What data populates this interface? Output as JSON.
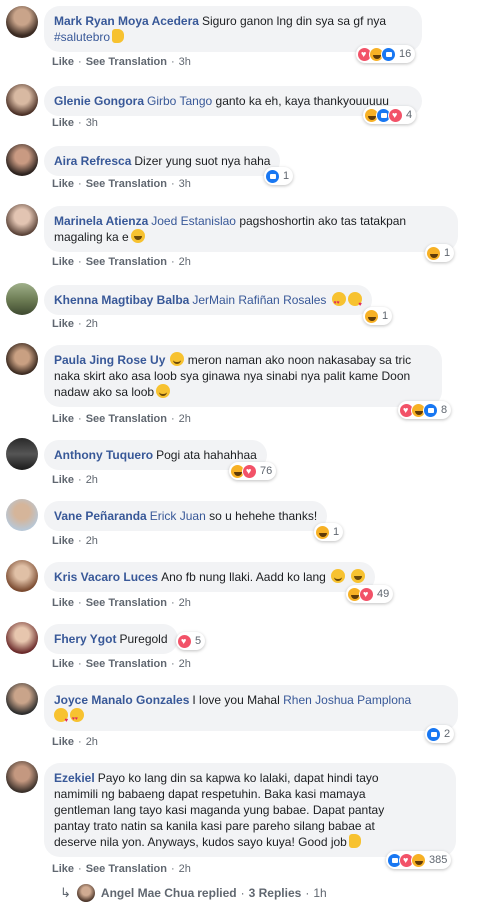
{
  "labels": {
    "like": "Like",
    "see_translation": "See Translation",
    "sep": "·"
  },
  "colors": {
    "author": "#385898",
    "bubble": "#f2f3f5",
    "meta": "#606770",
    "like_blue": "#1877f2",
    "love_red": "#f25268",
    "haha_yellow": "#f7b125"
  },
  "comments": [
    {
      "author": "Mark Ryan Moya Acedera",
      "text1": "Siguro ganon lng din sya sa gf nya",
      "text2": "#salutebro",
      "emoji": [
        "thumbs-up"
      ],
      "see_translation": true,
      "time": "3h",
      "reactions": [
        "love",
        "haha",
        "like"
      ],
      "count": "16"
    },
    {
      "author": "Glenie Gongora",
      "mention": "Girbo Tango",
      "text": "ganto ka eh, kaya thankyouuuuu",
      "see_translation": false,
      "time": "3h",
      "reactions": [
        "haha",
        "like",
        "love"
      ],
      "count": "4"
    },
    {
      "author": "Aira Refresca",
      "text": "Dizer yung suot nya haha",
      "see_translation": true,
      "time": "3h",
      "reactions": [
        "like"
      ],
      "count": "1"
    },
    {
      "author": "Marinela Atienza",
      "mention": "Joed Estanislao",
      "text": "pagshoshortin ako tas tatakpan",
      "text2": "magaling ka e",
      "emoji": [
        "grin"
      ],
      "see_translation": true,
      "time": "2h",
      "reactions": [
        "haha"
      ],
      "count": "1"
    },
    {
      "author": "Khenna Magtibay Balba",
      "mention": "JerMain Rafiñan Rosales",
      "emoji": [
        "heart-eyes",
        "kiss"
      ],
      "see_translation": false,
      "time": "2h",
      "reactions": [
        "haha"
      ],
      "count": "1"
    },
    {
      "author": "Paula Jing Rose Uy",
      "emoji_inline": [
        "smile"
      ],
      "text": "meron naman ako noon nakasabay sa tric",
      "text2": "naka skirt ako asa loob sya ginawa nya sinabi nya palit kame Doon",
      "text3": "nadaw ako sa loob",
      "emoji": [
        "smile"
      ],
      "see_translation": true,
      "time": "2h",
      "reactions": [
        "love",
        "haha",
        "like"
      ],
      "count": "8"
    },
    {
      "author": "Anthony Tuquero",
      "text": "Pogi ata hahahhaa",
      "see_translation": false,
      "time": "2h",
      "reactions": [
        "haha",
        "love"
      ],
      "count": "76"
    },
    {
      "author": "Vane Peñaranda",
      "mention": "Erick Juan",
      "text": "so u hehehe thanks!",
      "see_translation": false,
      "time": "2h",
      "reactions": [
        "haha"
      ],
      "count": "1"
    },
    {
      "author": "Kris Vacaro Luces",
      "text": "Ano fb nung llaki. Aadd ko lang",
      "emoji": [
        "smile",
        "grin"
      ],
      "see_translation": true,
      "time": "2h",
      "reactions": [
        "haha",
        "love"
      ],
      "count": "49"
    },
    {
      "author": "Fhery Ygot",
      "text": "Puregold",
      "see_translation": true,
      "time": "2h",
      "reactions": [
        "love"
      ],
      "count": "5"
    },
    {
      "author": "Joyce Manalo Gonzales",
      "text": "I love you Mahal",
      "mention": "Rhen Joshua Pamplona",
      "emoji": [
        "kiss",
        "heart-eyes"
      ],
      "see_translation": false,
      "time": "2h",
      "reactions": [
        "like"
      ],
      "count": "2"
    },
    {
      "author": "Ezekiel",
      "text": "Payo ko lang din sa kapwa ko lalaki, dapat hindi tayo",
      "text2": "namimili ng babaeng dapat respetuhin. Baka kasi mamaya",
      "text3": "gentleman lang tayo kasi maganda yung babae. Dapat pantay",
      "text4": "pantay trato natin sa kanila kasi pare pareho silang babae at",
      "text5": "deserve nila yon. Anyways, kudos sayo kuya! Good job",
      "emoji": [
        "thumbs-up"
      ],
      "see_translation": true,
      "time": "2h",
      "reactions": [
        "like",
        "love",
        "haha"
      ],
      "count": "385"
    }
  ],
  "replies": {
    "name": "Angel Mae Chua",
    "action": "replied",
    "count_label": "3 Replies",
    "time": "1h"
  }
}
